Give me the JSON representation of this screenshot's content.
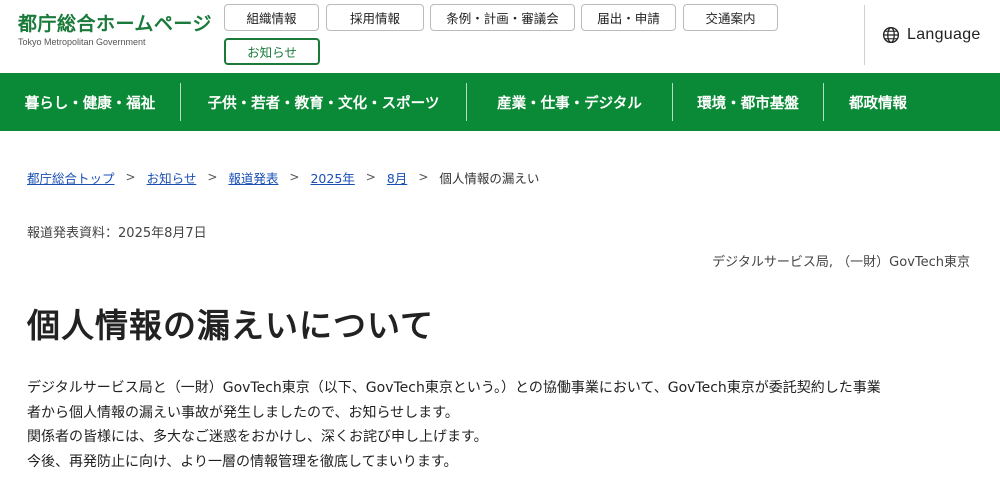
{
  "header": {
    "logo_title": "都庁総合ホームページ",
    "logo_subtitle": "Tokyo Metropolitan Government",
    "topnav": [
      "組織情報",
      "採用情報",
      "条例・計画・審議会",
      "届出・申請",
      "交通案内",
      "お知らせ"
    ],
    "language_label": "Language"
  },
  "mainnav": {
    "items": [
      "暮らし・健康・福祉",
      "子供・若者・教育・文化・スポーツ",
      "産業・仕事・デジタル",
      "環境・都市基盤",
      "都政情報"
    ]
  },
  "breadcrumb": {
    "links": [
      "都庁総合トップ",
      "お知らせ",
      "報道発表",
      "2025年",
      "8月"
    ],
    "current": "個人情報の漏えい",
    "separator": ">"
  },
  "article": {
    "press_label": "報道発表資料",
    "press_date": "2025年8月7日",
    "department": "デジタルサービス局, （一財）GovTech東京",
    "title": "個人情報の漏えいについて",
    "body_lines": [
      "デジタルサービス局と（一財）GovTech東京（以下、GovTech東京という。）との協働事業において、GovTech東京が委託契約した事業",
      "者から個人情報の漏えい事故が発生しましたので、お知らせします。",
      "関係者の皆様には、多大なご迷惑をおかけし、深くお詫び申し上げます。",
      "今後、再発防止に向け、より一層の情報管理を徹底してまいります。"
    ]
  },
  "colors": {
    "brand_green": "#1a7a3a",
    "nav_green": "#0a8a36",
    "link_blue": "#1a4fb5"
  },
  "icons": {
    "language": "globe-icon",
    "breadcrumb_separator": "chevron-right-icon"
  }
}
